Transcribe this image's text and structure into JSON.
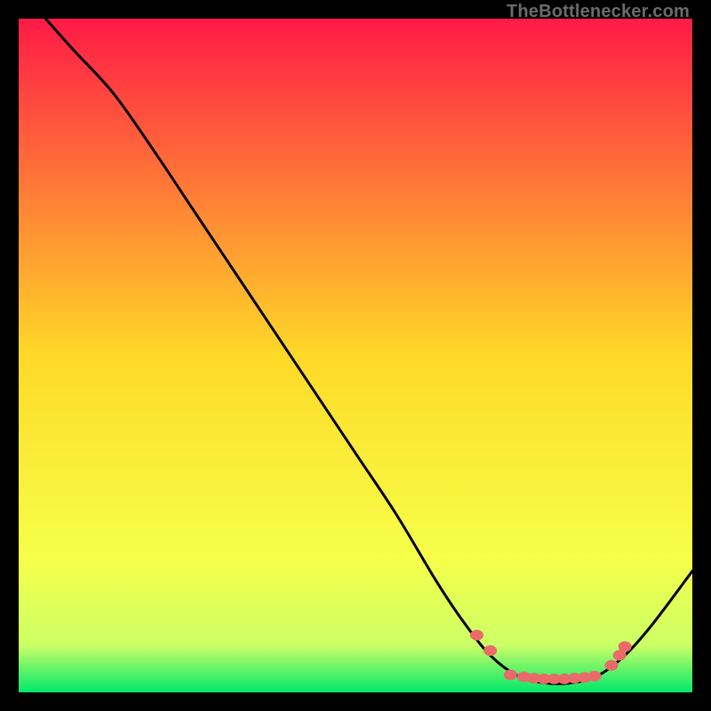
{
  "attribution": "TheBottlenecker.com",
  "chart_data": {
    "type": "line",
    "title": "",
    "xlabel": "",
    "ylabel": "",
    "xlim": [
      0,
      100
    ],
    "ylim": [
      0,
      100
    ],
    "gradient_stops": [
      {
        "offset": 0,
        "color": "#ff1a46"
      },
      {
        "offset": 0.5,
        "color": "#ffd928"
      },
      {
        "offset": 0.8,
        "color": "#f6ff49"
      },
      {
        "offset": 0.93,
        "color": "#ccff66"
      },
      {
        "offset": 1.0,
        "color": "#00e86b"
      }
    ],
    "curve": [
      {
        "x": 4,
        "y": 100
      },
      {
        "x": 8,
        "y": 95.5
      },
      {
        "x": 14,
        "y": 89
      },
      {
        "x": 20,
        "y": 80.5
      },
      {
        "x": 26,
        "y": 71.5
      },
      {
        "x": 32,
        "y": 62.5
      },
      {
        "x": 38,
        "y": 53.5
      },
      {
        "x": 44,
        "y": 44.5
      },
      {
        "x": 50,
        "y": 35.5
      },
      {
        "x": 56,
        "y": 26.5
      },
      {
        "x": 62,
        "y": 16.5
      },
      {
        "x": 66,
        "y": 10.5
      },
      {
        "x": 70,
        "y": 5.5
      },
      {
        "x": 74,
        "y": 2.5
      },
      {
        "x": 78,
        "y": 1.4
      },
      {
        "x": 82,
        "y": 1.4
      },
      {
        "x": 86,
        "y": 2.5
      },
      {
        "x": 90,
        "y": 5.5
      },
      {
        "x": 94,
        "y": 10
      },
      {
        "x": 100,
        "y": 18
      }
    ],
    "markers": [
      {
        "x": 68.0,
        "y": 8.5
      },
      {
        "x": 70.0,
        "y": 6.2
      },
      {
        "x": 73.0,
        "y": 2.6
      },
      {
        "x": 75.0,
        "y": 2.3
      },
      {
        "x": 76.5,
        "y": 2.1
      },
      {
        "x": 78.0,
        "y": 2.0
      },
      {
        "x": 79.5,
        "y": 2.0
      },
      {
        "x": 81.0,
        "y": 2.0
      },
      {
        "x": 82.5,
        "y": 2.1
      },
      {
        "x": 84.0,
        "y": 2.2
      },
      {
        "x": 85.5,
        "y": 2.4
      },
      {
        "x": 88.0,
        "y": 4.0
      },
      {
        "x": 89.2,
        "y": 5.5
      },
      {
        "x": 90.0,
        "y": 6.8
      }
    ]
  }
}
